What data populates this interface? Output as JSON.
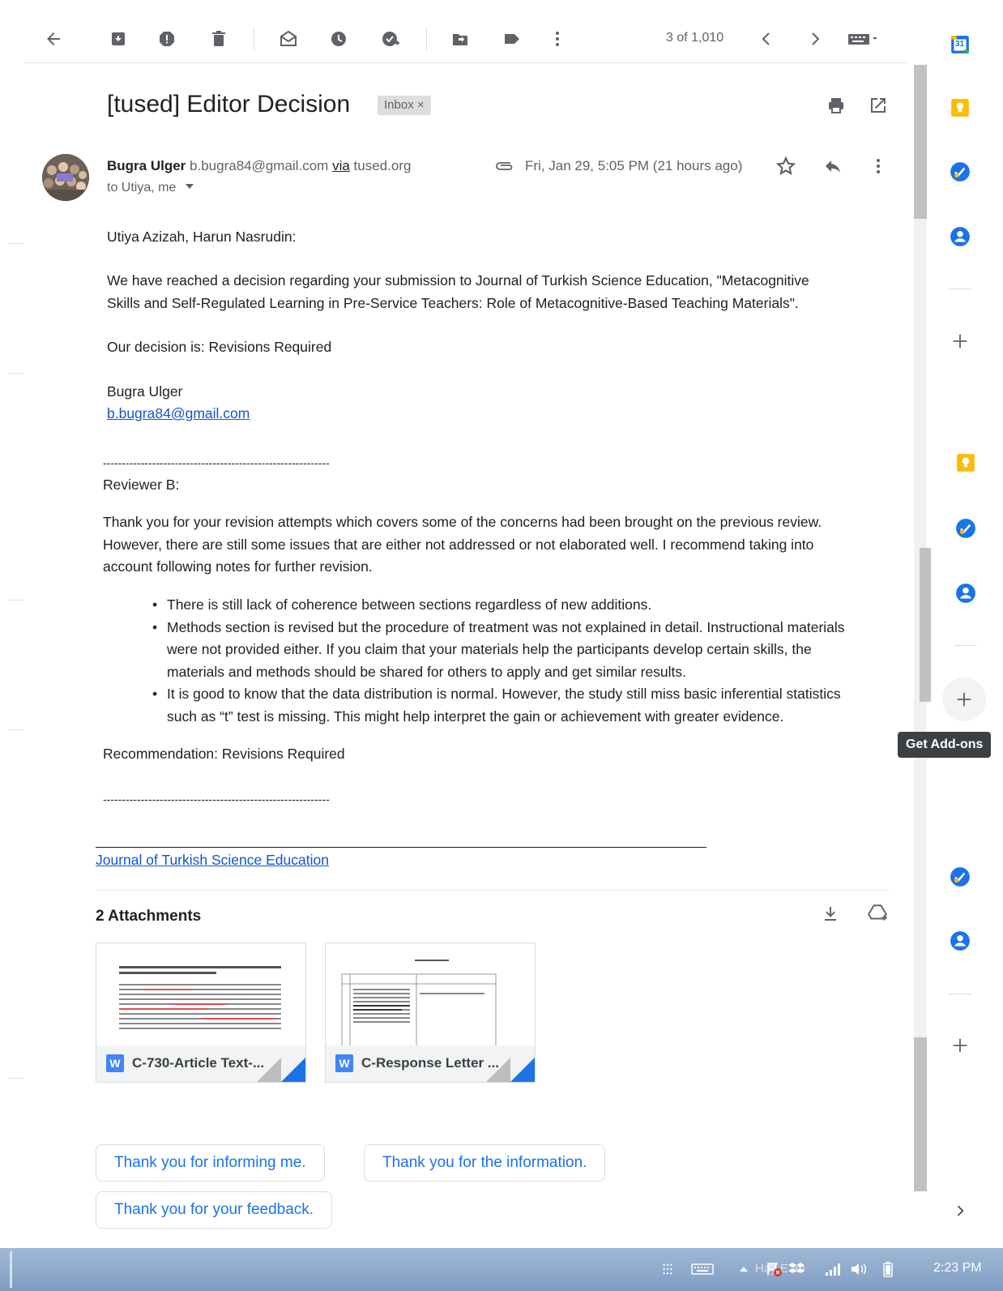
{
  "toolbar": {
    "count": "3 of 1,010",
    "icons": [
      "arrow-back-icon",
      "archive-icon",
      "report-spam-icon",
      "delete-icon",
      "mark-unread-icon",
      "snooze-icon",
      "add-to-tasks-icon",
      "move-to-icon",
      "label-icon",
      "more-vert-icon",
      "chevron-left-icon",
      "chevron-right-icon",
      "keyboard-icon"
    ]
  },
  "email": {
    "subject": "[tused] Editor Decision",
    "label_chip": "Inbox ×",
    "sender_name": "Bugra Ulger",
    "sender_email": "b.bugra84@gmail.com",
    "via_word": "via",
    "via_domain": "tused.org",
    "to_line": "to Utiya, me",
    "date": "Fri, Jan 29, 5:05 PM (21 hours ago)"
  },
  "body": {
    "greeting": "Utiya Azizah, Harun Nasrudin:",
    "para1_line1": "We have reached a decision regarding your submission to Journal of Turkish Science Education, \"Metacognitive",
    "para1_line2": "Skills and Self-Regulated Learning in Pre-Service Teachers: Role of Metacognitive-Based Teaching Materials\".",
    "decision": "Our decision is: Revisions Required",
    "editor_name": "Bugra Ulger",
    "editor_email": "b.bugra84@gmail.com",
    "dashes": "------------------------------------------------------------",
    "reviewer": "Reviewer B:",
    "review_line1": "Thank you for your revision attempts which covers some of the concerns had been brought on the previous review.",
    "review_line2": "However, there are still some issues that are either not addressed or not elaborated well. I recommend taking into",
    "review_line3": "account following notes for further revision.",
    "bullets": [
      [
        "There is still lack of coherence between sections regardless of new additions."
      ],
      [
        "Methods section is revised but the procedure of treatment was not explained in detail. Instructional materials",
        "were not provided either. If you claim that your materials help the participants develop certain skills, the",
        "materials and methods should be shared for others to apply and get similar results."
      ],
      [
        "It is good to know that the data distribution is normal. However, the study still miss basic inferential statistics",
        "such as “t” test is missing. This might help interpret the gain or achievement with greater evidence."
      ]
    ],
    "recommendation": "Recommendation: Revisions Required",
    "journal_link": "Journal of Turkish Science Education"
  },
  "attachments": {
    "title": "2 Attachments",
    "items": [
      {
        "name": "C-730-Article Text-...",
        "badge": "W"
      },
      {
        "name": "C-Response Letter ...",
        "badge": "W"
      }
    ]
  },
  "smart_replies": [
    "Thank you for informing me.",
    "Thank you for the information.",
    "Thank you for your feedback."
  ],
  "side_panel": {
    "calendar_day": "31",
    "tooltip": "Get Add-ons"
  },
  "taskbar": {
    "clock": "2:23 PM",
    "tray_text": "Hay  E  ab"
  },
  "colors": {
    "link": "#1155cc",
    "accent_blue": "#1a73e8",
    "keep_yellow": "#fbbc04",
    "tasks_blue": "#1a73e8",
    "contacts_blue": "#1a73e8"
  }
}
